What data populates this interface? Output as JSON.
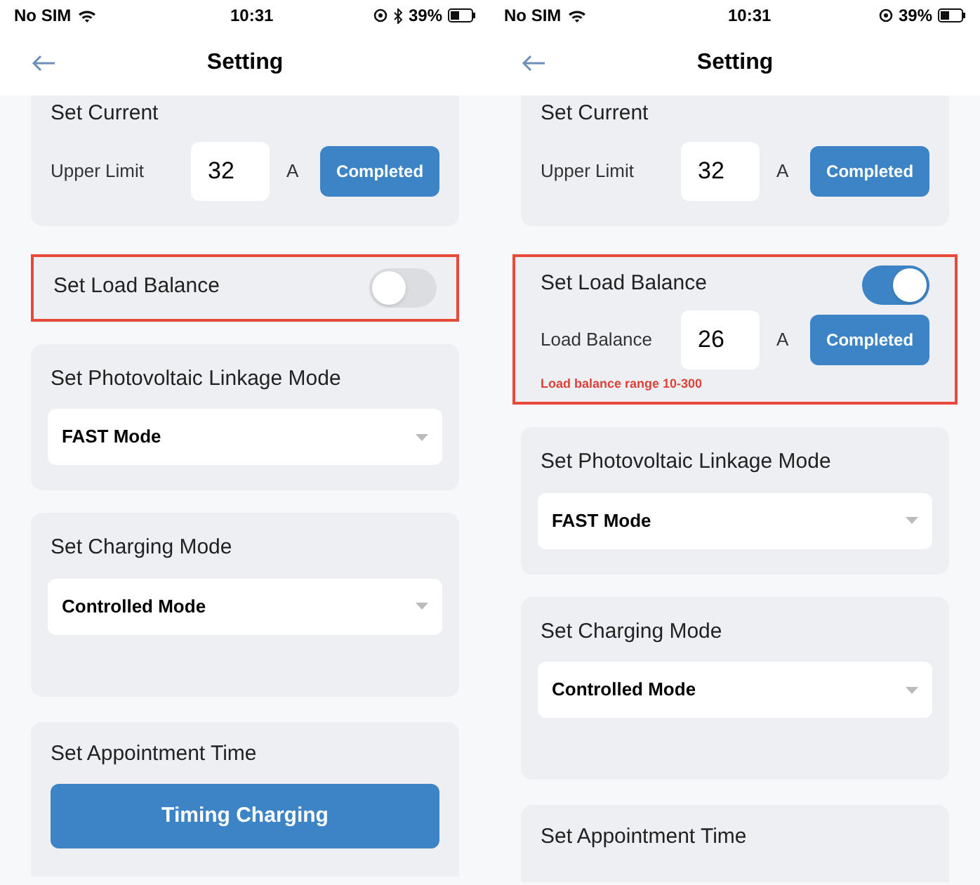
{
  "screens": [
    {
      "status_bar": {
        "carrier": "No SIM",
        "time": "10:31",
        "bluetooth": true,
        "battery": "39%"
      },
      "title": "Setting",
      "current": {
        "title": "Set Current",
        "label": "Upper Limit",
        "value": "32",
        "unit": "A",
        "button": "Completed"
      },
      "load_balance": {
        "title": "Set Load Balance",
        "on": false,
        "highlighted": true
      },
      "sections": [
        {
          "kind": "select",
          "title": "Set Photovoltaic Linkage Mode",
          "value": "FAST Mode"
        },
        {
          "kind": "select",
          "title": "Set Charging Mode",
          "value": "Controlled Mode"
        },
        {
          "kind": "action",
          "title": "Set Appointment Time",
          "button": "Timing Charging"
        }
      ]
    },
    {
      "status_bar": {
        "carrier": "No SIM",
        "time": "10:31",
        "bluetooth": false,
        "battery": "39%"
      },
      "title": "Setting",
      "current": {
        "title": "Set Current",
        "label": "Upper Limit",
        "value": "32",
        "unit": "A",
        "button": "Completed"
      },
      "load_balance": {
        "title": "Set Load Balance",
        "on": true,
        "highlighted": true,
        "label": "Load Balance",
        "value": "26",
        "unit": "A",
        "button": "Completed",
        "hint": "Load balance range 10-300"
      },
      "sections": [
        {
          "kind": "select",
          "title": "Set Photovoltaic Linkage Mode",
          "value": "FAST Mode"
        },
        {
          "kind": "select",
          "title": "Set Charging Mode",
          "value": "Controlled Mode"
        },
        {
          "kind": "action",
          "title": "Set Appointment Time"
        }
      ]
    }
  ]
}
